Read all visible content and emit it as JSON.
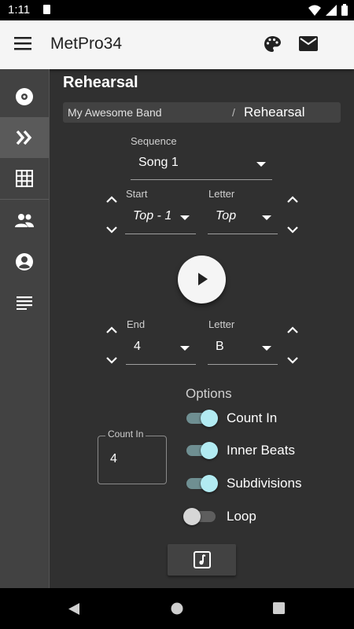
{
  "status_bar": {
    "time": "1:11"
  },
  "app_bar": {
    "title": "MetPro34"
  },
  "sidebar": {
    "items": [
      {
        "name": "disc",
        "icon": "disc-icon",
        "active": false
      },
      {
        "name": "rehearsal",
        "icon": "double-chevron-right-icon",
        "active": true
      },
      {
        "name": "grid",
        "icon": "grid-icon",
        "active": false
      },
      {
        "name": "band",
        "icon": "people-icon",
        "active": false
      },
      {
        "name": "account",
        "icon": "account-circle-icon",
        "active": false
      },
      {
        "name": "notes",
        "icon": "notes-icon",
        "active": false
      }
    ]
  },
  "page": {
    "title": "Rehearsal"
  },
  "breadcrumb": {
    "parent": "My Awesome Band",
    "separator": "/",
    "current": "Rehearsal"
  },
  "sequence": {
    "label": "Sequence",
    "value": "Song 1"
  },
  "start": {
    "label": "Start",
    "value": "Top - 1",
    "letter_label": "Letter",
    "letter_value": "Top"
  },
  "end": {
    "label": "End",
    "value": "4",
    "letter_label": "Letter",
    "letter_value": "B"
  },
  "options": {
    "title": "Options",
    "toggles": [
      {
        "label": "Count In",
        "on": true
      },
      {
        "label": "Inner Beats",
        "on": true
      },
      {
        "label": "Subdivisions",
        "on": true
      },
      {
        "label": "Loop",
        "on": false
      }
    ]
  },
  "count_in": {
    "label": "Count In",
    "value": "4"
  },
  "colors": {
    "accent": "#b2ebf2",
    "track_on": "#6f8f92",
    "background": "#303030"
  }
}
